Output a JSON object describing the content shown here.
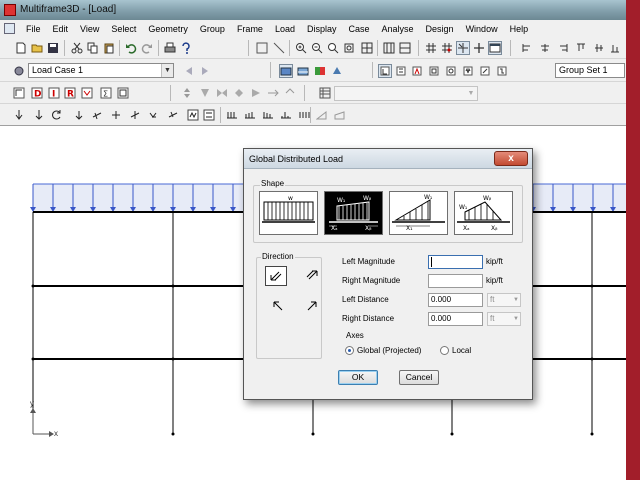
{
  "window": {
    "title": "Multiframe3D - [Load]"
  },
  "menu": [
    "File",
    "Edit",
    "View",
    "Select",
    "Geometry",
    "Group",
    "Frame",
    "Load",
    "Display",
    "Case",
    "Analyse",
    "Design",
    "Window",
    "Help"
  ],
  "toolbar": {
    "load_case": "Load Case 1",
    "group_set": "Group Set 1"
  },
  "icons": [
    "new-icon",
    "open-icon",
    "save-icon",
    "cut-icon",
    "copy-icon",
    "paste-icon",
    "undo-icon",
    "redo-icon",
    "print-icon",
    "help-icon",
    "zoom-in-icon",
    "zoom-out-icon",
    "select-icon",
    "pan-icon",
    "rotate-icon"
  ],
  "canvas": {
    "axis_x_label": "x",
    "axis_y_label": "y"
  },
  "dialog": {
    "title": "Global Distributed Load",
    "close_label": "x",
    "shape_label": "Shape",
    "shape_options": [
      "uniform",
      "trapezoidal-partial",
      "triangular",
      "triangular-partial"
    ],
    "shape_selected": "trapezoidal-partial",
    "shape_symbols": {
      "w": "w",
      "w1": "W₁",
      "wb": "Wᵦ",
      "xa": "Xₐ",
      "xb": "Xᵦ",
      "x1": "X₁"
    },
    "direction_label": "Direction",
    "fields": {
      "left_magnitude": {
        "label": "Left Magnitude",
        "value": "",
        "unit": "kip/ft"
      },
      "right_magnitude": {
        "label": "Right Magnitude",
        "value": "",
        "unit": "kip/ft"
      },
      "left_distance": {
        "label": "Left Distance",
        "value": "0.000",
        "unit": "ft"
      },
      "right_distance": {
        "label": "Right Distance",
        "value": "0.000",
        "unit": "ft"
      }
    },
    "axes_label": "Axes",
    "axes_options": {
      "global": "Global (Projected)",
      "local": "Local"
    },
    "axes_selected": "global",
    "ok_label": "OK",
    "cancel_label": "Cancel"
  }
}
